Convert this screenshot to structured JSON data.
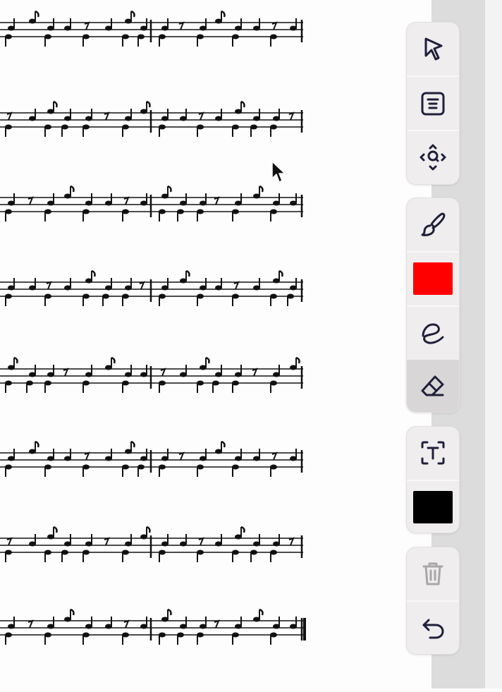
{
  "toolbar": {
    "groups": [
      {
        "tools": [
          {
            "name": "select-tool-button",
            "icon": "cursor-arrow-icon"
          },
          {
            "name": "page-menu-button",
            "icon": "document-lines-icon"
          },
          {
            "name": "zoom-pan-button",
            "icon": "zoom-move-icon"
          }
        ]
      },
      {
        "tools": [
          {
            "name": "pen-tool-button",
            "icon": "paintbrush-icon"
          },
          {
            "name": "pen-color-button",
            "icon": "color-swatch",
            "color": "#ff0000"
          },
          {
            "name": "freehand-tool-button",
            "icon": "scribble-icon"
          },
          {
            "name": "eraser-tool-button",
            "icon": "eraser-icon",
            "active": true
          }
        ]
      },
      {
        "tools": [
          {
            "name": "text-tool-button",
            "icon": "text-box-icon"
          },
          {
            "name": "text-color-button",
            "icon": "color-swatch",
            "color": "#000000"
          }
        ]
      },
      {
        "tools": [
          {
            "name": "delete-button",
            "icon": "trash-icon",
            "disabled": true
          },
          {
            "name": "undo-button",
            "icon": "undo-arrow-icon"
          }
        ]
      }
    ]
  },
  "colors": {
    "pen": "#ff0000",
    "text": "#000000",
    "icon": "#1f1f3a",
    "disabled_icon": "#a8a8a8"
  }
}
